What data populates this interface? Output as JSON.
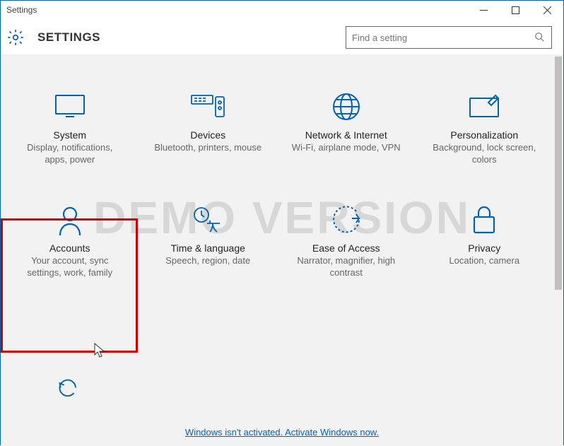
{
  "window": {
    "title": "Settings"
  },
  "header": {
    "title": "SETTINGS"
  },
  "search": {
    "placeholder": "Find a setting"
  },
  "tiles": [
    {
      "title": "System",
      "desc": "Display, notifications, apps, power"
    },
    {
      "title": "Devices",
      "desc": "Bluetooth, printers, mouse"
    },
    {
      "title": "Network & Internet",
      "desc": "Wi-Fi, airplane mode, VPN"
    },
    {
      "title": "Personalization",
      "desc": "Background, lock screen, colors"
    },
    {
      "title": "Accounts",
      "desc": "Your account, sync settings, work, family"
    },
    {
      "title": "Time & language",
      "desc": "Speech, region, date"
    },
    {
      "title": "Ease of Access",
      "desc": "Narrator, magnifier, high contrast"
    },
    {
      "title": "Privacy",
      "desc": "Location, camera"
    }
  ],
  "watermark": "DEMO VERSION",
  "activation_link": "Windows isn't activated. Activate Windows now."
}
